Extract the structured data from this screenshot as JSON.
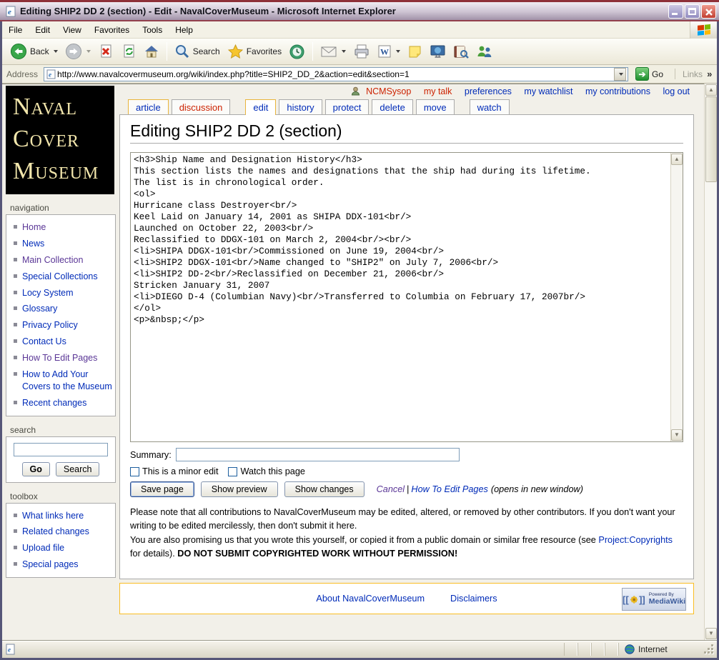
{
  "window": {
    "title": "Editing SHIP2 DD 2 (section) - Edit - NavalCoverMuseum - Microsoft Internet Explorer",
    "menu": {
      "items": [
        "File",
        "Edit",
        "View",
        "Favorites",
        "Tools",
        "Help"
      ]
    },
    "toolbar": {
      "back_label": "Back",
      "search_label": "Search",
      "favorites_label": "Favorites"
    },
    "address": {
      "label": "Address",
      "url": "http://www.navalcovermuseum.org/wiki/index.php?title=SHIP2_DD_2&action=edit&section=1",
      "go_label": "Go",
      "links_label": "Links",
      "links_chevron": "»"
    },
    "status": {
      "zone": "Internet"
    }
  },
  "sidebar": {
    "logo_lines": [
      "Naval",
      "Cover",
      "Museum"
    ],
    "navigation": {
      "title": "navigation",
      "items": [
        {
          "label": "Home",
          "visited": true
        },
        {
          "label": "News",
          "visited": false
        },
        {
          "label": "Main Collection",
          "visited": true
        },
        {
          "label": "Special Collections",
          "visited": false
        },
        {
          "label": "Locy System",
          "visited": false
        },
        {
          "label": "Glossary",
          "visited": false
        },
        {
          "label": "Privacy Policy",
          "visited": false
        },
        {
          "label": "Contact Us",
          "visited": false
        },
        {
          "label": "How To Edit Pages",
          "visited": true
        },
        {
          "label": "How to Add Your Covers to the Museum",
          "visited": false
        },
        {
          "label": "Recent changes",
          "visited": false
        }
      ]
    },
    "search": {
      "title": "search",
      "go_label": "Go",
      "search_label": "Search"
    },
    "toolbox": {
      "title": "toolbox",
      "items": [
        "What links here",
        "Related changes",
        "Upload file",
        "Special pages"
      ]
    }
  },
  "wiki": {
    "userbar": {
      "username": "NCMSysop",
      "my_talk": "my talk",
      "preferences": "preferences",
      "my_watchlist": "my watchlist",
      "my_contributions": "my contributions",
      "log_out": "log out"
    },
    "tabs": [
      {
        "label": "article"
      },
      {
        "label": "discussion"
      },
      {
        "label": "edit"
      },
      {
        "label": "history"
      },
      {
        "label": "protect"
      },
      {
        "label": "delete"
      },
      {
        "label": "move"
      },
      {
        "label": "watch"
      }
    ],
    "page_title": "Editing SHIP2 DD 2 (section)",
    "editor": {
      "content": "<h3>Ship Name and Designation History</h3>\nThis section lists the names and designations that the ship had during its lifetime.\nThe list is in chronological order.\n<ol>\nHurricane class Destroyer<br/>\nKeel Laid on January 14, 2001 as SHIPA DDX-101<br/>\nLaunched on October 22, 2003<br/>\nReclassified to DDGX-101 on March 2, 2004<br/><br/>\n<li>SHIPA DDGX-101<br/>Commissioned on June 19, 2004<br/>\n<li>SHIP2 DDGX-101<br/>Name changed to \"SHIP2\" on July 7, 2006<br/>\n<li>SHIP2 DD-2<br/>Reclassified on December 21, 2006<br/>\nStricken January 31, 2007\n<li>DIEGO D-4 (Columbian Navy)<br/>Transferred to Columbia on February 17, 2007br/>\n</ol>\n<p>&nbsp;</p>"
    },
    "summary_label": "Summary:",
    "minor_edit_label": "This is a minor edit",
    "watch_label": "Watch this page",
    "buttons": {
      "save": "Save page",
      "preview": "Show preview",
      "changes": "Show changes"
    },
    "cancel_label": "Cancel",
    "pipe": "|",
    "help_link": "How To Edit Pages",
    "help_suffix": "(opens in new window)",
    "notice": {
      "para1": "Please note that all contributions to NavalCoverMuseum may be edited, altered, or removed by other contributors. If you don't want your writing to be edited mercilessly, then don't submit it here.",
      "para2_pre": "You are also promising us that you wrote this yourself, or copied it from a public domain or similar free resource (see ",
      "copyright_link": "Project:Copyrights",
      "para2_post": " for details). ",
      "warning": "DO NOT SUBMIT COPYRIGHTED WORK WITHOUT PERMISSION!"
    },
    "footer": {
      "about": "About NavalCoverMuseum",
      "disclaimers": "Disclaimers",
      "badge_top": "Powered By",
      "badge_bottom": "MediaWiki"
    }
  }
}
